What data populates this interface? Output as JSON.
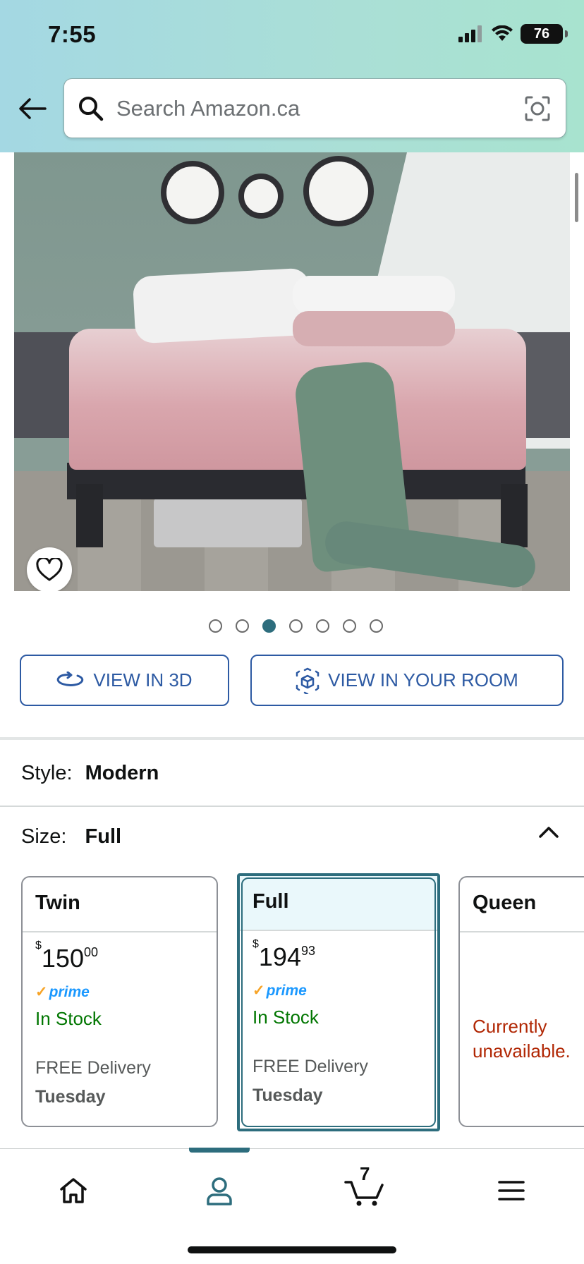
{
  "status_bar": {
    "time": "7:55",
    "battery": "76"
  },
  "search": {
    "placeholder": "Search Amazon.ca"
  },
  "carousel": {
    "total_dots": 7,
    "active_index": 2
  },
  "view_buttons": {
    "view_3d": "VIEW IN 3D",
    "view_room": "VIEW IN YOUR ROOM"
  },
  "style": {
    "label": "Style:",
    "value": "Modern"
  },
  "size": {
    "label": "Size:",
    "value": "Full"
  },
  "size_options": [
    {
      "name": "Twin",
      "currency": "$",
      "price_whole": "150",
      "price_cents": "00",
      "prime": "prime",
      "stock": "In Stock",
      "delivery": "FREE Delivery",
      "delivery_day": "Tuesday"
    },
    {
      "name": "Full",
      "currency": "$",
      "price_whole": "194",
      "price_cents": "93",
      "prime": "prime",
      "stock": "In Stock",
      "delivery": "FREE Delivery",
      "delivery_day": "Tuesday"
    },
    {
      "name": "Queen",
      "availability": "Currently unavailable."
    }
  ],
  "bottom_nav": {
    "cart_count": "7"
  },
  "colors": {
    "accent": "#2d6d7d",
    "link_blue": "#2d5aa3",
    "in_stock": "#007600",
    "unavailable": "#b12704",
    "prime": "#1a98ff"
  }
}
